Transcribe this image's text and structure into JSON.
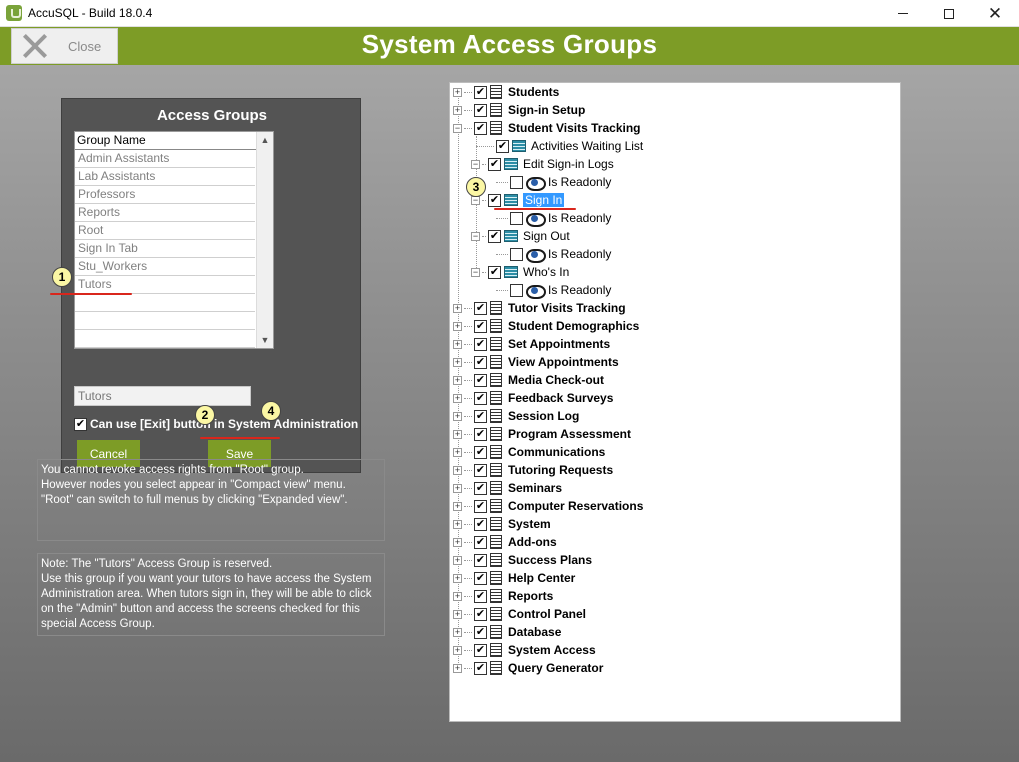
{
  "window": {
    "title": "AccuSQL - Build 18.0.4",
    "minimize_glyph": "",
    "close_glyph": "✕"
  },
  "toolbar": {
    "close_label": "Close"
  },
  "page_title": "System Access Groups",
  "access_groups": {
    "panel_title": "Access Groups",
    "column_header": "Group Name",
    "groups": [
      "Admin Assistants",
      "Lab Assistants",
      "Professors",
      "Reports",
      "Root",
      "Sign In Tab",
      "Stu_Workers",
      "Tutors"
    ],
    "selected_group": "Tutors",
    "exit_checkbox_label": "Can use [Exit] button in System Administration",
    "exit_checkbox_checked": true,
    "cancel_label": "Cancel",
    "save_label": "Save"
  },
  "info": {
    "root_note": "You cannot revoke access rights from \"Root\" group.\nHowever nodes you select appear in \"Compact view\" menu.\n\"Root\" can switch to full menus by clicking \"Expanded view\".",
    "tutors_note": "Note:  The \"Tutors\" Access Group is reserved.\nUse this group if you want your tutors to have access the System Administration area. When tutors sign in, they will be able to click on the \"Admin\" button and access the screens checked for this special Access Group."
  },
  "tree": {
    "top_nodes": [
      "Students",
      "Sign-in Setup",
      "Student Visits Tracking",
      "Tutor Visits Tracking",
      "Student Demographics",
      "Set Appointments",
      "View Appointments",
      "Media Check-out",
      "Feedback Surveys",
      "Session Log",
      "Program Assessment",
      "Communications",
      "Tutoring Requests",
      "Seminars",
      "Computer Reservations",
      "System",
      "Add-ons",
      "Success Plans",
      "Help Center",
      "Reports",
      "Control Panel",
      "Database",
      "System Access",
      "Query Generator"
    ],
    "student_visits_children": {
      "activities_waiting_list": "Activities Waiting List",
      "edit_signin_logs": "Edit Sign-in Logs",
      "sign_in": "Sign In",
      "sign_out": "Sign Out",
      "whos_in": "Who's In",
      "readonly": "Is Readonly"
    },
    "selected_node": "Sign In"
  },
  "annotations": [
    "1",
    "2",
    "3",
    "4"
  ],
  "colors": {
    "accent_green": "#7d9c26",
    "selection_blue": "#3399ff",
    "marker_yellow": "#fbf7a4",
    "underline_red": "#d9261c"
  }
}
